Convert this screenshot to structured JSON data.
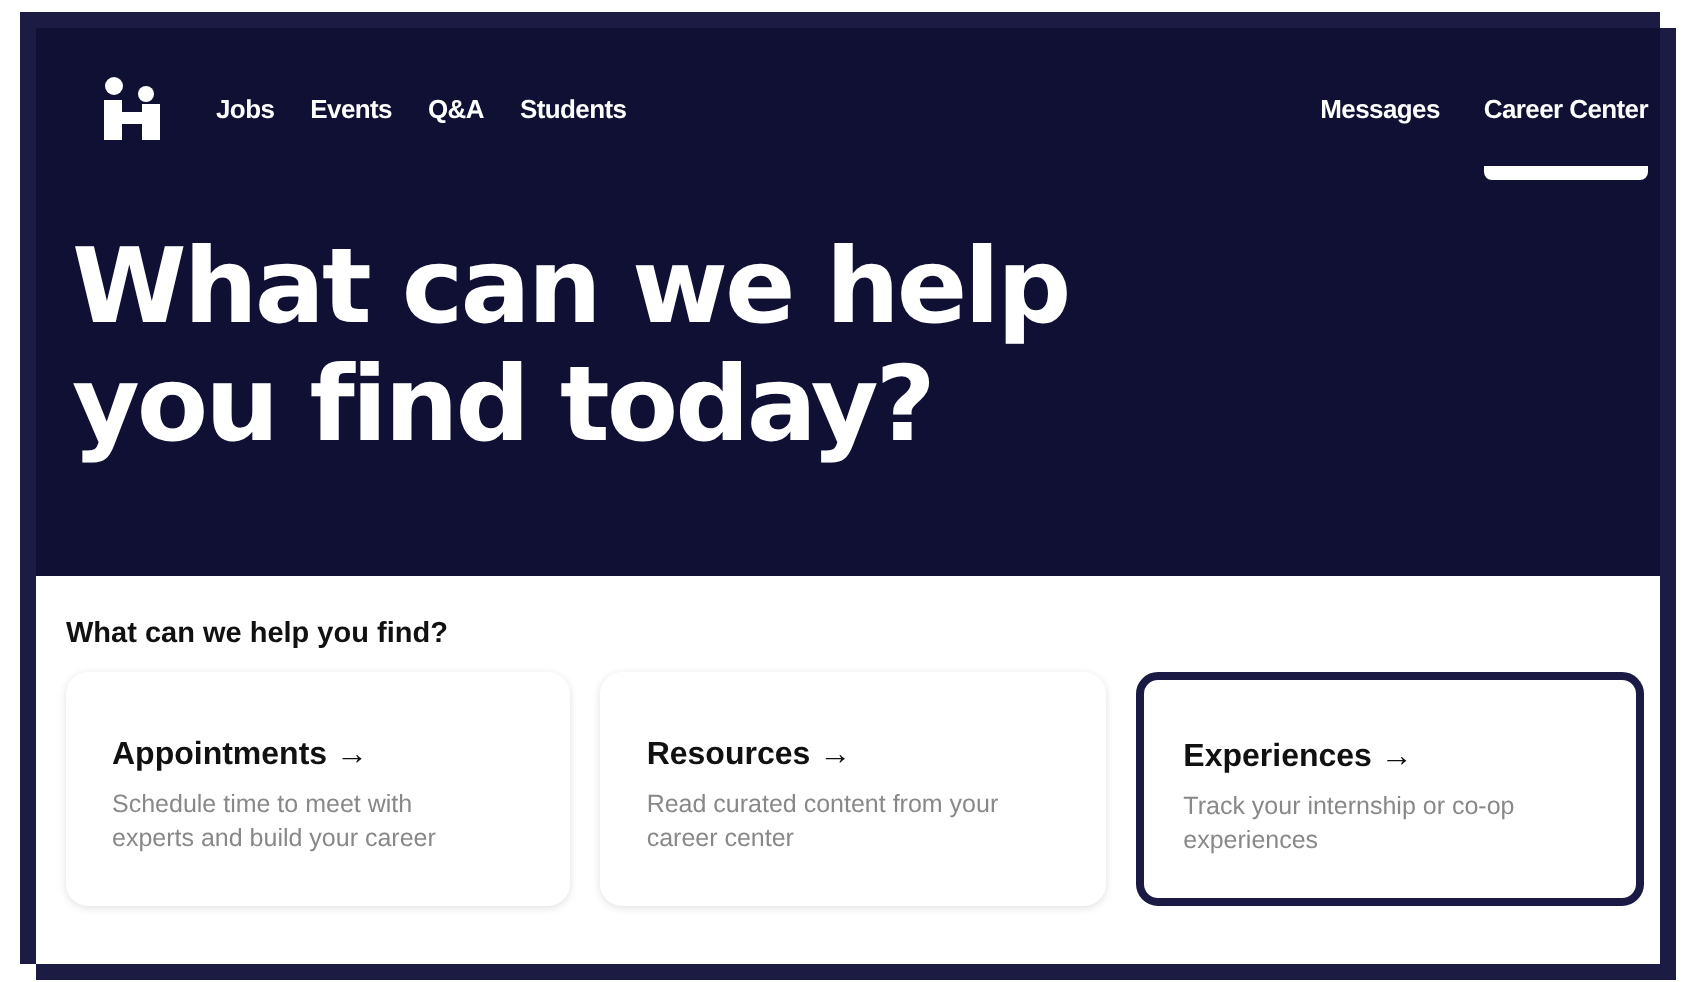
{
  "nav": {
    "left": [
      {
        "label": "Jobs",
        "selected": false
      },
      {
        "label": "Events",
        "selected": false
      },
      {
        "label": "Q&A",
        "selected": false
      },
      {
        "label": "Students",
        "selected": false
      }
    ],
    "right": [
      {
        "label": "Messages",
        "selected": false
      },
      {
        "label": "Career Center",
        "selected": true
      }
    ]
  },
  "hero": {
    "title_lines": [
      "What can we help",
      "you find today?"
    ]
  },
  "section": {
    "heading": "What can we help you find?",
    "cards": [
      {
        "title": "Appointments →",
        "description": "Schedule time to meet with experts and build your career",
        "selected": false
      },
      {
        "title": "Resources →",
        "description": "Read curated content from your career center",
        "selected": false
      },
      {
        "title": "Experiences →",
        "description": "Track your internship or co-op experiences",
        "selected": true
      }
    ]
  }
}
